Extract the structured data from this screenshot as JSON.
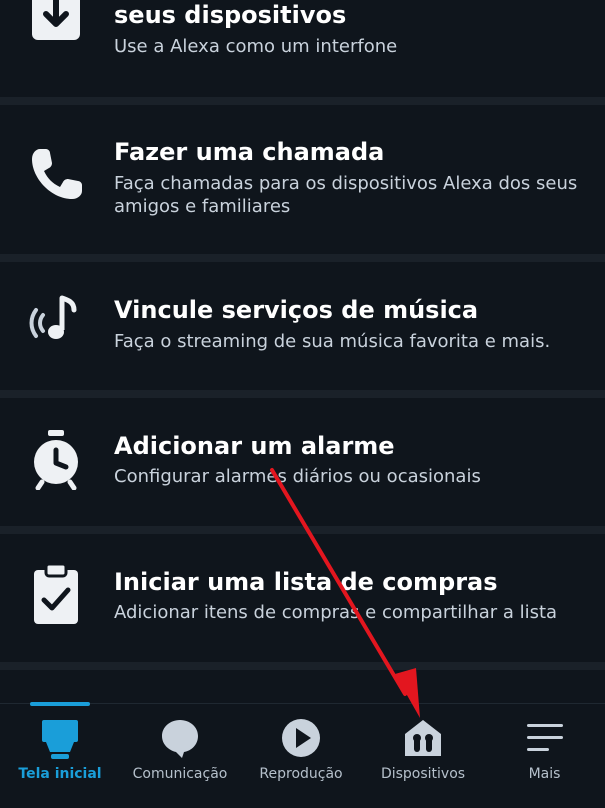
{
  "cards": [
    {
      "title": "seus dispositivos",
      "subtitle": "Use a Alexa como um interfone",
      "icon": "download-icon"
    },
    {
      "title": "Fazer uma chamada",
      "subtitle": "Faça chamadas para os dispositivos Alexa dos seus amigos e familiares",
      "icon": "phone-icon"
    },
    {
      "title": "Vincule serviços de música",
      "subtitle": "Faça o streaming de sua música favorita e mais.",
      "icon": "music-icon"
    },
    {
      "title": "Adicionar um alarme",
      "subtitle": "Configurar alarmes diários ou ocasionais",
      "icon": "alarm-icon"
    },
    {
      "title": "Iniciar uma lista de compras",
      "subtitle": "Adicionar itens de compras e compartilhar a lista",
      "icon": "clipboard-icon"
    }
  ],
  "nav": {
    "items": [
      {
        "label": "Tela inicial",
        "icon": "home-icon",
        "active": true
      },
      {
        "label": "Comunicação",
        "icon": "chat-icon",
        "active": false
      },
      {
        "label": "Reprodução",
        "icon": "play-icon",
        "active": false
      },
      {
        "label": "Dispositivos",
        "icon": "devices-icon",
        "active": false
      },
      {
        "label": "Mais",
        "icon": "menu-icon",
        "active": false
      }
    ]
  },
  "colors": {
    "accent": "#1a9ed9",
    "background": "#0f151c",
    "divider": "#1a2129",
    "annotation_arrow": "#e3161f"
  }
}
